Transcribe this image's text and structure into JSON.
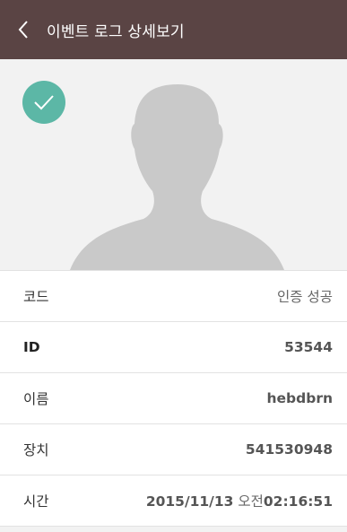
{
  "app_bar": {
    "title": "이벤트 로그 상세보기",
    "background": "#5a4444",
    "back_icon": "chevron-left-icon"
  },
  "photo": {
    "status_icon": "check-icon",
    "status_color": "#5cb7a6",
    "placeholder": "person-silhouette"
  },
  "details": {
    "rows": [
      {
        "label": "코드",
        "value": "인증 성공"
      },
      {
        "label": "ID",
        "value": "53544"
      },
      {
        "label": "이름",
        "value": "hebdbrn"
      },
      {
        "label": "장치",
        "value": "541530948"
      },
      {
        "label": "시간",
        "date": "2015/11/13",
        "ampm": "오전",
        "clock": "02:16:51"
      }
    ]
  }
}
